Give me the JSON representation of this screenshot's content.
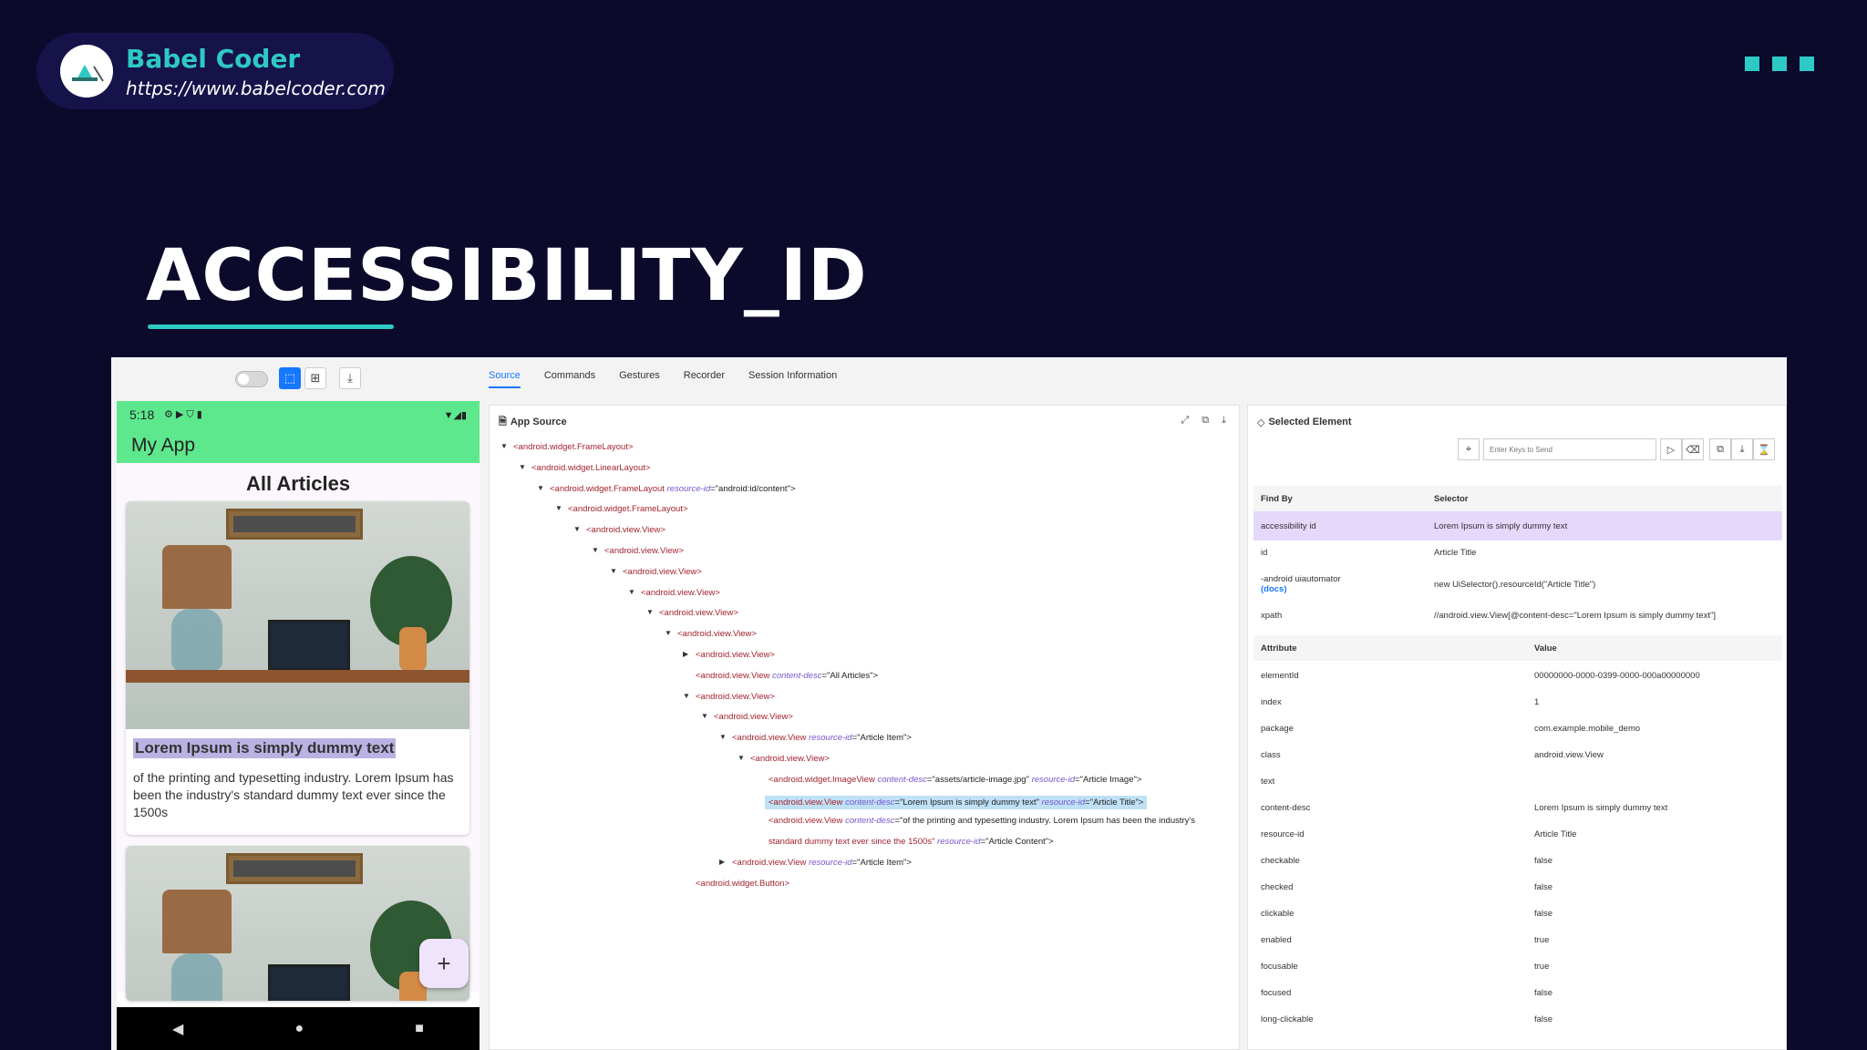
{
  "brand": {
    "name": "Babel Coder",
    "url": "https://www.babelcoder.com"
  },
  "slide_title": "ACCESSIBILITY_ID",
  "colors": {
    "background": "#0b0a2b",
    "accent": "#2ec9c4",
    "appbar": "#5de88e",
    "link": "#1677ff"
  },
  "inspector": {
    "tabs": [
      "Source",
      "Commands",
      "Gestures",
      "Recorder",
      "Session Information"
    ],
    "active_tab": "Source",
    "app_source_title": "App Source",
    "selected_element_title": "Selected Element",
    "keys_placeholder": "Enter Keys to Send",
    "tree": [
      {
        "text": "<android.widget.FrameLayout>",
        "arrow": "▼"
      },
      {
        "text": "<android.widget.LinearLayout>",
        "arrow": "▼"
      },
      {
        "pre": "<android.widget.FrameLayout ",
        "attr": "resource-id",
        "val": "=\"android:id/content\">",
        "arrow": "▼"
      },
      {
        "text": "<android.widget.FrameLayout>",
        "arrow": "▼"
      },
      {
        "text": "<android.view.View>",
        "arrow": "▼"
      },
      {
        "text": "<android.view.View>",
        "arrow": "▼"
      },
      {
        "text": "<android.view.View>",
        "arrow": "▼"
      },
      {
        "text": "<android.view.View>",
        "arrow": "▼"
      },
      {
        "text": "<android.view.View>",
        "arrow": "▼"
      },
      {
        "text": "<android.view.View>",
        "arrow": "▼"
      },
      {
        "text": "<android.view.View>",
        "arrow": "▶"
      },
      {
        "pre": "<android.view.View ",
        "attr": "content-desc",
        "val": "=\"All Articles\">",
        "arrow": ""
      },
      {
        "text": "<android.view.View>",
        "arrow": "▼"
      },
      {
        "text": "<android.view.View>",
        "arrow": "▼"
      },
      {
        "pre": "<android.view.View ",
        "attr": "resource-id",
        "val": "=\"Article Item\">",
        "arrow": "▼"
      },
      {
        "text": "<android.view.View>",
        "arrow": "▼"
      },
      {
        "pre": "<android.widget.ImageView ",
        "attr": "content-desc",
        "val": "=\"assets/article-image.jpg\" ",
        "attr2": "resource-id",
        "val2": "=\"Article Image\">",
        "arrow": ""
      },
      {
        "pre": "<android.view.View ",
        "attr": "content-desc",
        "val": "=\"Lorem Ipsum is simply dummy text\" ",
        "attr2": "resource-id",
        "val2": "=\"Article Title\">",
        "arrow": ""
      },
      {
        "pre": "<android.view.View ",
        "attr": "content-desc",
        "val": "=\"of the printing and typesetting industry. Lorem Ipsum has been the industry's",
        "arrow": ""
      },
      {
        "pre": "standard dummy text ever since the 1500s\" ",
        "attr": "resource-id",
        "val": "=\"Article Content\">",
        "arrow": ""
      },
      {
        "pre": "<android.view.View ",
        "attr": "resource-id",
        "val": "=\"Article Item\">",
        "arrow": "▶"
      },
      {
        "text": "<android.widget.Button>",
        "arrow": ""
      }
    ],
    "selector_headers": [
      "Find By",
      "Selector"
    ],
    "selectors": [
      {
        "by": "accessibility id",
        "value": "Lorem Ipsum is simply dummy text"
      },
      {
        "by": "id",
        "value": "Article Title"
      },
      {
        "by": "-android uiautomator",
        "docs": "(docs)",
        "value": "new UiSelector().resourceId(\"Article Title\")"
      },
      {
        "by": "xpath",
        "value": "//android.view.View[@content-desc=\"Lorem Ipsum is simply dummy text\"]"
      }
    ],
    "attribute_headers": [
      "Attribute",
      "Value"
    ],
    "attributes": [
      {
        "name": "elementId",
        "value": "00000000-0000-0399-0000-000a00000000"
      },
      {
        "name": "index",
        "value": "1"
      },
      {
        "name": "package",
        "value": "com.example.mobile_demo"
      },
      {
        "name": "class",
        "value": "android.view.View"
      },
      {
        "name": "text",
        "value": ""
      },
      {
        "name": "content-desc",
        "value": "Lorem Ipsum is simply dummy text"
      },
      {
        "name": "resource-id",
        "value": "Article Title"
      },
      {
        "name": "checkable",
        "value": "false"
      },
      {
        "name": "checked",
        "value": "false"
      },
      {
        "name": "clickable",
        "value": "false"
      },
      {
        "name": "enabled",
        "value": "true"
      },
      {
        "name": "focusable",
        "value": "true"
      },
      {
        "name": "focused",
        "value": "false"
      },
      {
        "name": "long-clickable",
        "value": "false"
      }
    ]
  },
  "phone": {
    "time": "5:18",
    "app_title": "My App",
    "heading": "All Articles",
    "article_title": "Lorem Ipsum is simply dummy text",
    "article_text": "of the printing and typesetting industry. Lorem Ipsum has been the industry's standard dummy text ever since the 1500s",
    "fab_label": "+",
    "nav": [
      "◀",
      "●",
      "■"
    ]
  }
}
